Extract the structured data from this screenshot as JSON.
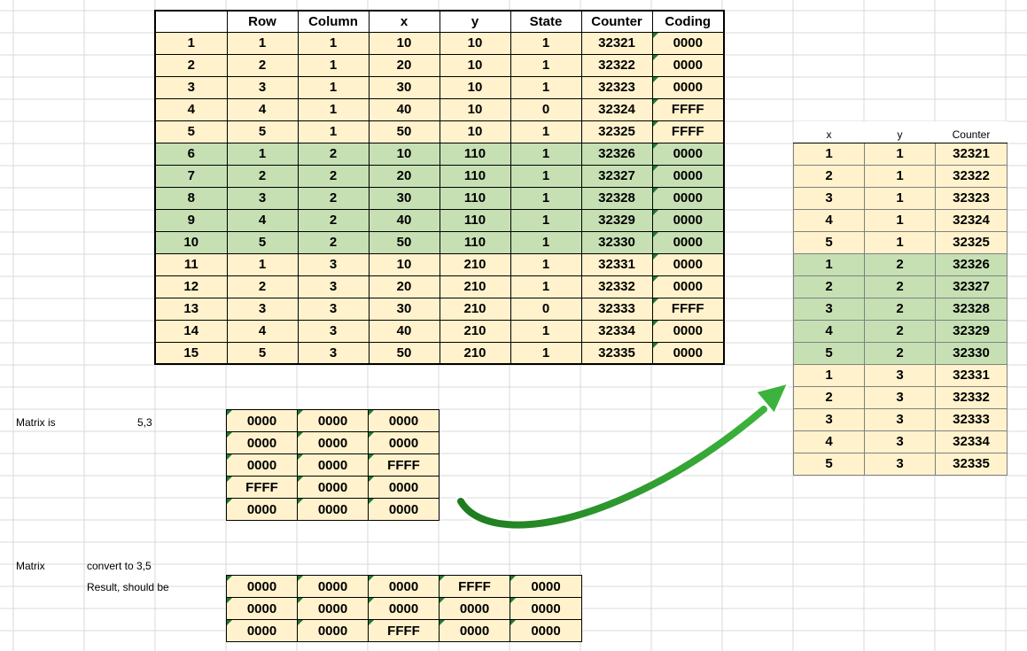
{
  "main_table": {
    "headers": [
      "",
      "Row",
      "Column",
      "x",
      "y",
      "State",
      "Counter",
      "Coding"
    ],
    "rows": [
      [
        "1",
        "1",
        "1",
        "10",
        "10",
        "1",
        "32321",
        "0000"
      ],
      [
        "2",
        "2",
        "1",
        "20",
        "10",
        "1",
        "32322",
        "0000"
      ],
      [
        "3",
        "3",
        "1",
        "30",
        "10",
        "1",
        "32323",
        "0000"
      ],
      [
        "4",
        "4",
        "1",
        "40",
        "10",
        "0",
        "32324",
        "FFFF"
      ],
      [
        "5",
        "5",
        "1",
        "50",
        "10",
        "1",
        "32325",
        "FFFF"
      ],
      [
        "6",
        "1",
        "2",
        "10",
        "110",
        "1",
        "32326",
        "0000"
      ],
      [
        "7",
        "2",
        "2",
        "20",
        "110",
        "1",
        "32327",
        "0000"
      ],
      [
        "8",
        "3",
        "2",
        "30",
        "110",
        "1",
        "32328",
        "0000"
      ],
      [
        "9",
        "4",
        "2",
        "40",
        "110",
        "1",
        "32329",
        "0000"
      ],
      [
        "10",
        "5",
        "2",
        "50",
        "110",
        "1",
        "32330",
        "0000"
      ],
      [
        "11",
        "1",
        "3",
        "10",
        "210",
        "1",
        "32331",
        "0000"
      ],
      [
        "12",
        "2",
        "3",
        "20",
        "210",
        "1",
        "32332",
        "0000"
      ],
      [
        "13",
        "3",
        "3",
        "30",
        "210",
        "0",
        "32333",
        "FFFF"
      ],
      [
        "14",
        "4",
        "3",
        "40",
        "210",
        "1",
        "32334",
        "0000"
      ],
      [
        "15",
        "5",
        "3",
        "50",
        "210",
        "1",
        "32335",
        "0000"
      ]
    ],
    "green_rows": [
      5,
      6,
      7,
      8,
      9
    ]
  },
  "right_table": {
    "headers": [
      "x",
      "y",
      "Counter"
    ],
    "rows": [
      [
        "1",
        "1",
        "32321"
      ],
      [
        "2",
        "1",
        "32322"
      ],
      [
        "3",
        "1",
        "32323"
      ],
      [
        "4",
        "1",
        "32324"
      ],
      [
        "5",
        "1",
        "32325"
      ],
      [
        "1",
        "2",
        "32326"
      ],
      [
        "2",
        "2",
        "32327"
      ],
      [
        "3",
        "2",
        "32328"
      ],
      [
        "4",
        "2",
        "32329"
      ],
      [
        "5",
        "2",
        "32330"
      ],
      [
        "1",
        "3",
        "32331"
      ],
      [
        "2",
        "3",
        "32332"
      ],
      [
        "3",
        "3",
        "32333"
      ],
      [
        "4",
        "3",
        "32334"
      ],
      [
        "5",
        "3",
        "32335"
      ]
    ],
    "green_rows": [
      5,
      6,
      7,
      8,
      9
    ]
  },
  "labels": {
    "matrix_is": "Matrix is",
    "matrix_dims": "5,3",
    "matrix": "Matrix",
    "convert": "convert to 3,5",
    "result": "Result, should be"
  },
  "matrix_5x3": [
    [
      "0000",
      "0000",
      "0000"
    ],
    [
      "0000",
      "0000",
      "0000"
    ],
    [
      "0000",
      "0000",
      "FFFF"
    ],
    [
      "FFFF",
      "0000",
      "0000"
    ],
    [
      "0000",
      "0000",
      "0000"
    ]
  ],
  "matrix_3x5": [
    [
      "0000",
      "0000",
      "0000",
      "FFFF",
      "0000"
    ],
    [
      "0000",
      "0000",
      "0000",
      "0000",
      "0000"
    ],
    [
      "0000",
      "0000",
      "FFFF",
      "0000",
      "0000"
    ]
  ],
  "colors": {
    "cell_fill": "#FFF2CC",
    "highlight_fill": "#C6E0B4",
    "gridline": "#D9D9D9",
    "arrow": "#2E9B2E"
  }
}
